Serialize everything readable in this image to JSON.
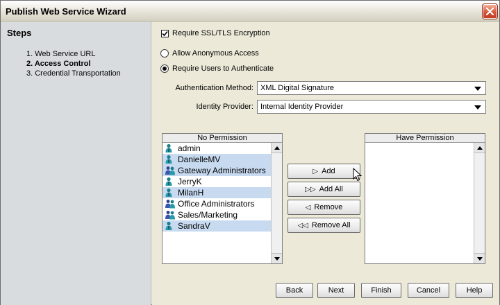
{
  "window": {
    "title": "Publish Web Service Wizard"
  },
  "steps": {
    "title": "Steps",
    "items": [
      {
        "label": "1. Web Service URL",
        "active": false
      },
      {
        "label": "2. Access Control",
        "active": true
      },
      {
        "label": "3. Credential Transportation",
        "active": false
      }
    ]
  },
  "options": {
    "require_ssl": {
      "label": "Require SSL/TLS Encryption",
      "checked": true
    },
    "allow_anonymous": {
      "label": "Allow Anonymous Access",
      "selected": false
    },
    "require_auth": {
      "label": "Require Users to Authenticate",
      "selected": true
    }
  },
  "auth": {
    "method_label": "Authentication Method:",
    "method_value": "XML Digital Signature",
    "provider_label": "Identity Provider:",
    "provider_value": "Internal Identity Provider"
  },
  "no_permission": {
    "header": "No Permission",
    "items": [
      {
        "name": "admin",
        "type": "user",
        "selected": false
      },
      {
        "name": "DanielleMV",
        "type": "user",
        "selected": true
      },
      {
        "name": "Gateway Administrators",
        "type": "group",
        "selected": true
      },
      {
        "name": "JerryK",
        "type": "user",
        "selected": false
      },
      {
        "name": "MilanH",
        "type": "user",
        "selected": true
      },
      {
        "name": "Office Administrators",
        "type": "group",
        "selected": false
      },
      {
        "name": "Sales/Marketing",
        "type": "group",
        "selected": false
      },
      {
        "name": "SandraV",
        "type": "user",
        "selected": true
      }
    ]
  },
  "have_permission": {
    "header": "Have Permission",
    "items": []
  },
  "transfer_buttons": {
    "add": "Add",
    "add_all": "Add All",
    "remove": "Remove",
    "remove_all": "Remove All"
  },
  "footer": {
    "back": "Back",
    "next": "Next",
    "finish": "Finish",
    "cancel": "Cancel",
    "help": "Help"
  },
  "icons": {
    "user": "user-icon",
    "group": "group-icon",
    "close": "close-icon"
  },
  "colors": {
    "selection": "#c7daf0",
    "sidebar": "#d9dcdf",
    "background": "#ece9d8",
    "close_button": "#d8543a"
  }
}
